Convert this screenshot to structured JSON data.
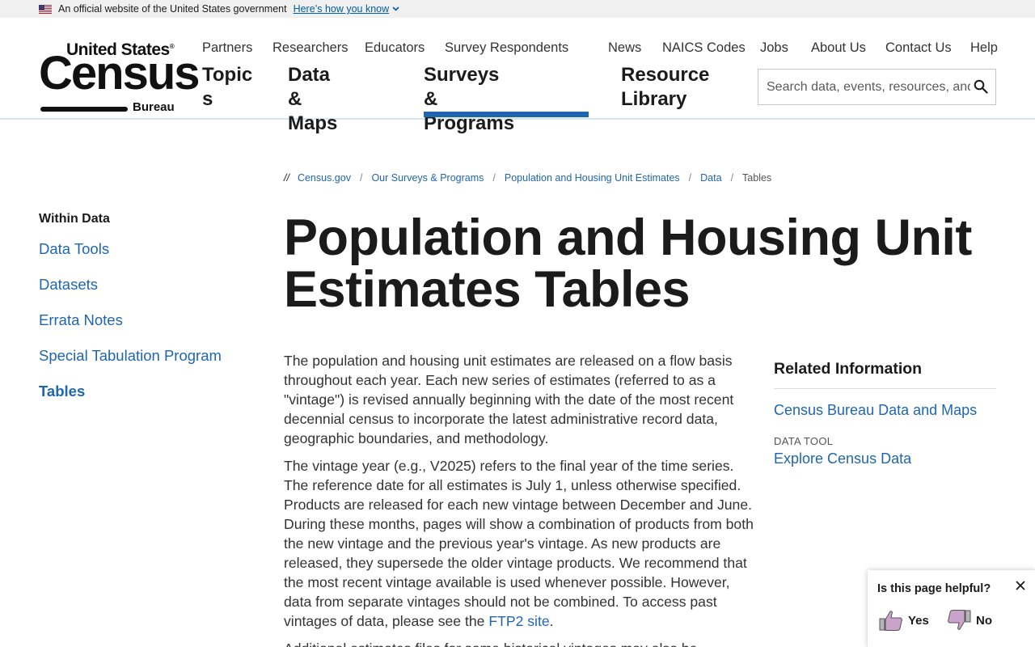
{
  "gov_banner": {
    "text": "An official website of the United States government",
    "link": "Here’s how you know"
  },
  "logo": {
    "top": "United States",
    "reg": "®",
    "main": "Census",
    "sub": "Bureau"
  },
  "utility_nav": [
    "Partners",
    "Researchers",
    "Educators",
    "Survey Respondents",
    "News",
    "NAICS Codes",
    "Jobs",
    "About Us",
    "Contact Us",
    "Help"
  ],
  "main_nav": {
    "topics_l1": "Topic",
    "topics_l2": "s",
    "data_l1": "Data &",
    "data_l2": "Maps",
    "surveys_l1": "Surveys &",
    "surveys_l2": "Programs",
    "resource_l1": "Resource",
    "resource_l2": "Library"
  },
  "search": {
    "placeholder": "Search data, events, resources, and more"
  },
  "sidebar": {
    "heading": "Within Data",
    "items": [
      "Data Tools",
      "Datasets",
      "Errata Notes",
      "Special Tabulation Program",
      "Tables"
    ]
  },
  "breadcrumb": {
    "prefix": "//",
    "items": [
      "Census.gov",
      "Our Surveys & Programs",
      "Population and Housing Unit Estimates",
      "Data"
    ],
    "current": "Tables",
    "sep": "/"
  },
  "title": {
    "line1": "Population and Housing Unit",
    "line2": "Estimates Tables"
  },
  "content": {
    "p1": "The population and housing unit estimates are released on a flow basis throughout each year. Each new series of estimates (referred to as a \"vintage\") is revised annually beginning with the date of the most recent decennial census to incorporate the latest administrative record data, geographic boundaries, and methodology.",
    "p2": "The vintage year (e.g., V2025) refers to the final year of the time series. The reference date for all estimates is July 1, unless otherwise specified. Products are released for each new vintage between December and June. During these months, pages will show a combination of products from both the new vintage and the previous year's vintage. As new products are released, they supersede the older vintage products. We recommend that the most recent vintage available is used whenever possible. However, data from separate vintages should not be combined. To access past vintages of data, please see the",
    "p2_link": "FTP2 site",
    "p2_end": ".",
    "p3": "Additional estimates files for some historical vintages may also be"
  },
  "related": {
    "heading": "Related Information",
    "link1": "Census Bureau Data and Maps",
    "label": "DATA TOOL",
    "link2": "Explore Census Data"
  },
  "feedback": {
    "question": "Is this page helpful?",
    "yes": "Yes",
    "no": "No"
  }
}
